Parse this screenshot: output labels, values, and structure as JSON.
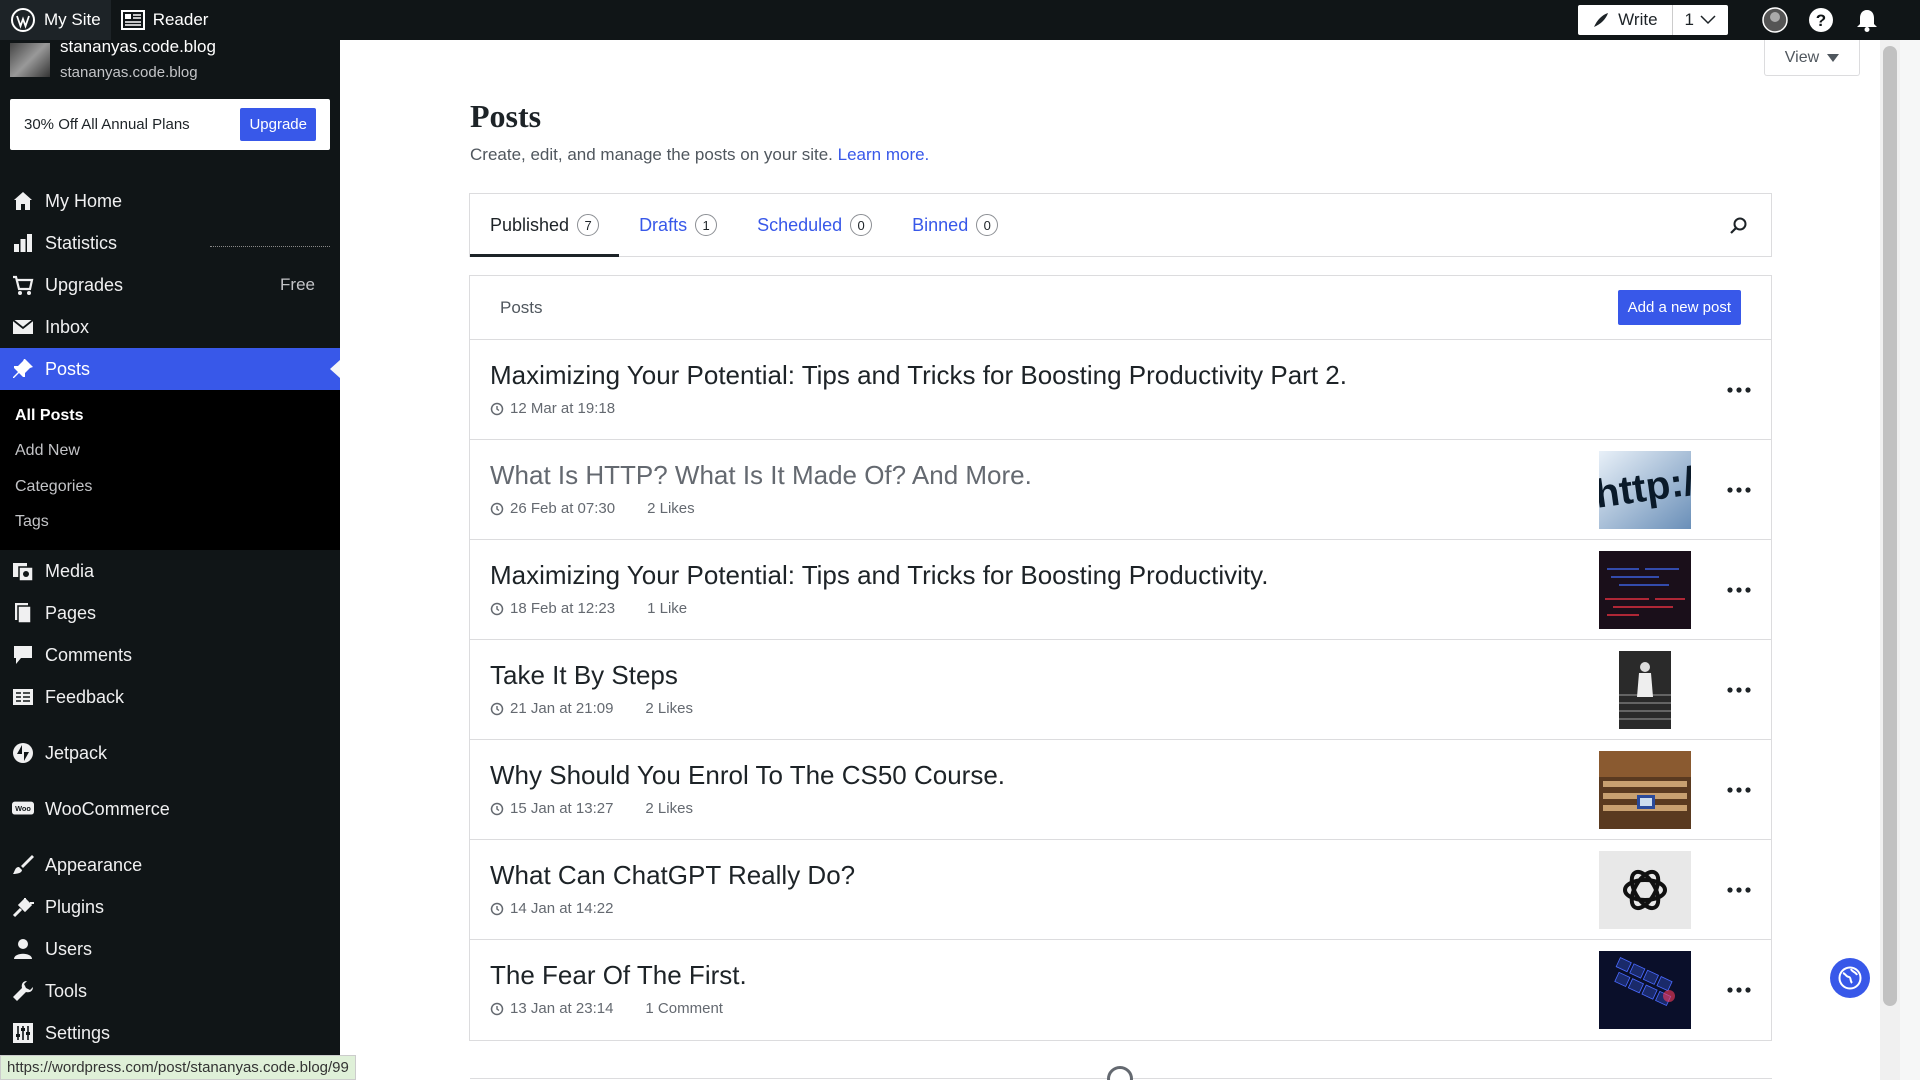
{
  "topbar": {
    "my_site": "My Site",
    "reader": "Reader",
    "write": "Write",
    "write_count": "1"
  },
  "site": {
    "name": "stananyas.code.blog",
    "url": "stananyas.code.blog"
  },
  "promo": {
    "text": "30% Off All Annual Plans",
    "button": "Upgrade"
  },
  "nav": {
    "my_home": "My Home",
    "statistics": "Statistics",
    "upgrades": "Upgrades",
    "upgrades_badge": "Free",
    "inbox": "Inbox",
    "posts": "Posts",
    "media": "Media",
    "pages": "Pages",
    "comments": "Comments",
    "feedback": "Feedback",
    "jetpack": "Jetpack",
    "woocommerce": "WooCommerce",
    "appearance": "Appearance",
    "plugins": "Plugins",
    "users": "Users",
    "tools": "Tools",
    "settings": "Settings"
  },
  "subnav": {
    "all_posts": "All Posts",
    "add_new": "Add New",
    "categories": "Categories",
    "tags": "Tags"
  },
  "main": {
    "view": "View",
    "title": "Posts",
    "subtitle": "Create, edit, and manage the posts on your site.",
    "learn_more": "Learn more.",
    "list_header": "Posts",
    "add_new_post": "Add a new post"
  },
  "tabs": [
    {
      "label": "Published",
      "count": "7"
    },
    {
      "label": "Drafts",
      "count": "1"
    },
    {
      "label": "Scheduled",
      "count": "0"
    },
    {
      "label": "Binned",
      "count": "0"
    }
  ],
  "posts": [
    {
      "title": "Maximizing Your Potential: Tips and Tricks for Boosting Productivity Part 2.",
      "date": "12 Mar at 19:18",
      "likes": "",
      "thumb": "none"
    },
    {
      "title": "What Is HTTP? What Is It Made Of? And More.",
      "date": "26 Feb at 07:30",
      "likes": "2 Likes",
      "thumb": "http",
      "title_color": "#646970"
    },
    {
      "title": "Maximizing Your Potential: Tips and Tricks for Boosting Productivity.",
      "date": "18 Feb at 12:23",
      "likes": "1 Like",
      "thumb": "code"
    },
    {
      "title": "Take It By Steps",
      "date": "21 Jan at 21:09",
      "likes": "2 Likes",
      "thumb": "steps"
    },
    {
      "title": "Why Should You Enrol To The CS50 Course.",
      "date": "15 Jan at 13:27",
      "likes": "2 Likes",
      "thumb": "lecture"
    },
    {
      "title": "What Can ChatGPT Really Do?",
      "date": "14 Jan at 14:22",
      "likes": "",
      "thumb": "openai"
    },
    {
      "title": "The Fear Of The First.",
      "date": "13 Jan at 23:14",
      "likes": "1 Comment",
      "thumb": "keyboard"
    }
  ],
  "status_url": "https://wordpress.com/post/stananyas.code.blog/99",
  "colors": {
    "accent": "#3858e9",
    "sidebar": "#101517"
  }
}
